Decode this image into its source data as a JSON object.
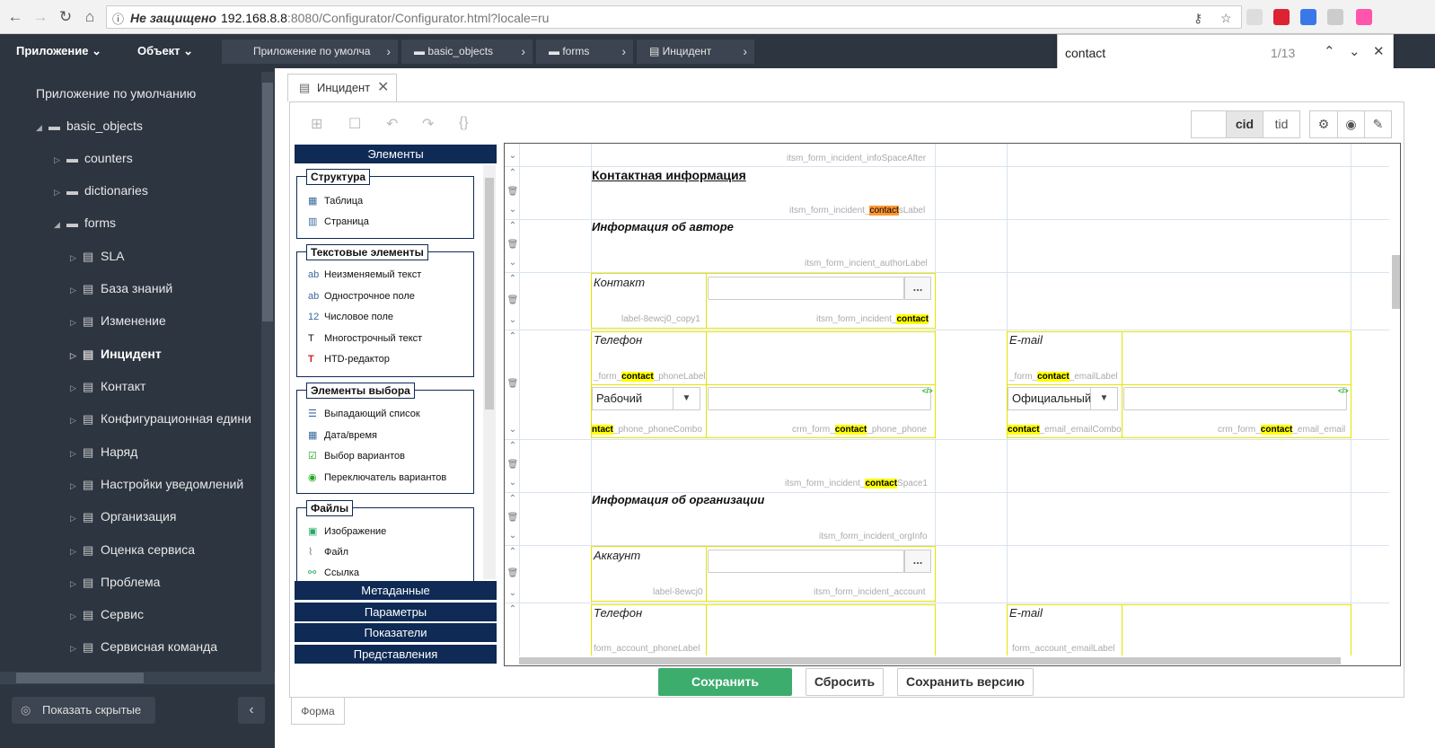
{
  "browser": {
    "security": "Не защищено",
    "url_host": "192.168.8.8",
    "url_rest": ":8080/Configurator/Configurator.html?locale=ru",
    "find": {
      "query": "contact",
      "count": "1/13"
    }
  },
  "appbar": {
    "menu_app": "Приложение",
    "menu_object": "Объект",
    "breadcrumbs": [
      "Приложение по умолча",
      "basic_objects",
      "forms",
      "Инцидент"
    ]
  },
  "sidebar": {
    "root": "Приложение по умолчанию",
    "basic_objects": "basic_objects",
    "counters": "counters",
    "dictionaries": "dictionaries",
    "forms": "forms",
    "items": [
      "SLA",
      "База знаний",
      "Изменение",
      "Инцидент",
      "Контакт",
      "Конфигурационная едини",
      "Наряд",
      "Настройки уведомлений",
      "Организация",
      "Оценка сервиса",
      "Проблема",
      "Сервис",
      "Сервисная команда"
    ],
    "show_hidden": "Показать скрытые"
  },
  "tab": {
    "label": "Инцидент"
  },
  "toolbar": {
    "cid": "cid",
    "tid": "tid"
  },
  "palette": {
    "header": "Элементы",
    "groups": [
      {
        "title": "Структура",
        "items": [
          "Таблица",
          "Страница"
        ]
      },
      {
        "title": "Текстовые элементы",
        "items": [
          "Неизменяемый текст",
          "Однострочное поле",
          "Числовое поле",
          "Многострочный текст",
          "HTD-редактор"
        ]
      },
      {
        "title": "Элементы выбора",
        "items": [
          "Выпадающий список",
          "Дата/время",
          "Выбор вариантов",
          "Переключатель вариантов"
        ]
      },
      {
        "title": "Файлы",
        "items": [
          "Изображение",
          "Файл",
          "Ссылка"
        ]
      }
    ],
    "sections": [
      "Метаданные",
      "Параметры",
      "Показатели",
      "Представления"
    ]
  },
  "canvas": {
    "row0_id": "itsm_form_incident_infoSpaceAfter",
    "contact_info": "Контактная информация",
    "contact_info_id_pre": "itsm_form_incident_",
    "contact_info_id_hl": "contact",
    "contact_info_id_post": "sLabel",
    "author_info": "Информация об авторе",
    "author_info_id": "itsm_form_incient_authorLabel",
    "contact_label": "Контакт",
    "contact_label_id": "label-8ewcj0_copy1",
    "contact_field_id_pre": "itsm_form_incident_",
    "contact_field_id_hl": "contact",
    "phone_label": "Телефон",
    "phone_label_id_pre": "_form_",
    "phone_label_id_hl": "contact",
    "phone_label_id_post": "_phoneLabel",
    "phone_combo": "Рабочий",
    "phone_combo_id_hl": "ntact",
    "phone_combo_id_post": "_phone_phoneCombo",
    "phone_field_id_pre": "crm_form_",
    "phone_field_id_hl": "contact",
    "phone_field_id_post": "_phone_phone",
    "email_label": "E-mail",
    "email_label_id_pre": "_form_",
    "email_label_id_hl": "contact",
    "email_label_id_post": "_emailLabel",
    "email_combo": "Официальный",
    "email_combo_id_hl": "contact",
    "email_combo_id_post": "_email_emailCombo",
    "email_field_id_pre": "crm_form_",
    "email_field_id_hl": "contact",
    "email_field_id_post": "_email_email",
    "space1_id_pre": "itsm_form_incident_",
    "space1_id_hl": "contact",
    "space1_id_post": "Space1",
    "org_info": "Информация об организации",
    "org_info_id": "itsm_form_incident_orgInfo",
    "account_label": "Аккаунт",
    "account_label_id": "label-8ewcj0",
    "account_field_id": "itsm_form_incident_account",
    "phone2_label": "Телефон",
    "phone2_label_id": "form_account_phoneLabel",
    "email2_label": "E-mail",
    "email2_label_id": "form_account_emailLabel",
    "dots": "..."
  },
  "buttons": {
    "save": "Сохранить",
    "reset": "Сбросить",
    "save_version": "Сохранить версию"
  },
  "bottom_tab": "Форма"
}
